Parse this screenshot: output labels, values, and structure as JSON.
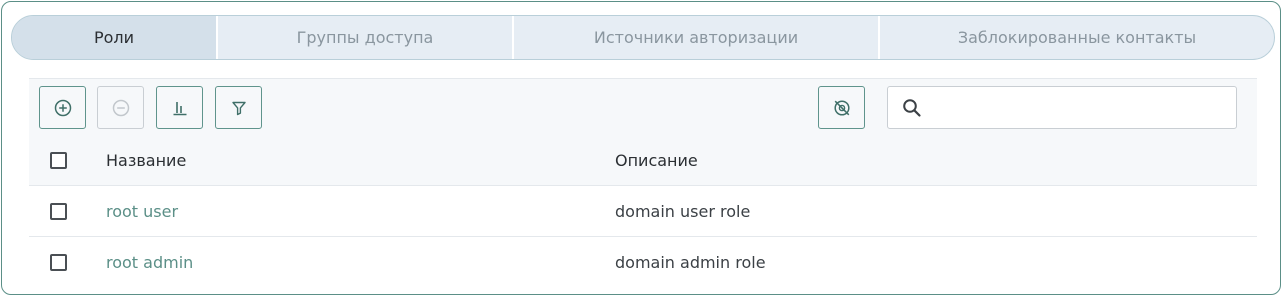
{
  "tabs": [
    {
      "label": "Роли",
      "active": true
    },
    {
      "label": "Группы доступа",
      "active": false
    },
    {
      "label": "Источники авторизации",
      "active": false
    },
    {
      "label": "Заблокированные контакты",
      "active": false
    }
  ],
  "toolbar": {
    "buttons": [
      {
        "icon": "plus-circle-icon",
        "enabled": true
      },
      {
        "icon": "minus-circle-icon",
        "enabled": false
      },
      {
        "icon": "bar-chart-icon",
        "enabled": true
      },
      {
        "icon": "filter-icon",
        "enabled": true
      },
      {
        "icon": "eye-off-icon",
        "enabled": true
      }
    ],
    "search": {
      "value": "",
      "placeholder": ""
    }
  },
  "table": {
    "columns": [
      "Название",
      "Описание"
    ],
    "rows": [
      {
        "name": "root user",
        "description": "domain user role"
      },
      {
        "name": "root admin",
        "description": "domain admin role"
      }
    ]
  },
  "colors": {
    "accent": "#5b8f87",
    "tab_bar_bg": "#e6edf4",
    "tab_active_bg": "#d4e0ea",
    "toolbar_bg": "#f6f8fa"
  }
}
